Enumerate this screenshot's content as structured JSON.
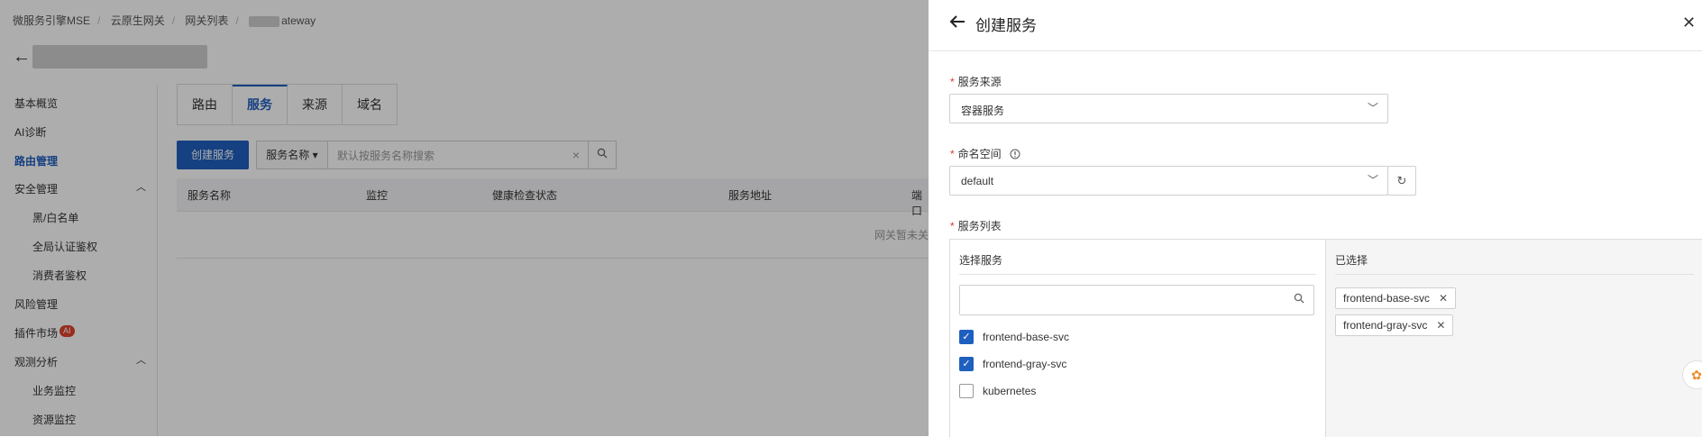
{
  "breadcrumb": [
    "微服务引擎MSE",
    "云原生网关",
    "网关列表",
    "ateway"
  ],
  "sidebar": {
    "items": [
      {
        "label": "基本概览"
      },
      {
        "label": "AI诊断"
      },
      {
        "label": "路由管理"
      },
      {
        "label": "安全管理"
      },
      {
        "label": "黑/白名单"
      },
      {
        "label": "全局认证鉴权"
      },
      {
        "label": "消费者鉴权"
      },
      {
        "label": "风险管理"
      },
      {
        "label": "插件市场",
        "badge": "AI"
      },
      {
        "label": "观测分析"
      },
      {
        "label": "业务监控"
      },
      {
        "label": "资源监控"
      }
    ]
  },
  "tabs": [
    "路由",
    "服务",
    "来源",
    "域名"
  ],
  "toolbar": {
    "create_label": "创建服务",
    "search_field_label": "服务名称",
    "search_placeholder": "默认按服务名称搜索"
  },
  "table": {
    "columns": [
      "服务名称",
      "监控",
      "健康检查状态",
      "服务地址",
      "端口"
    ],
    "empty_text": "网关暂未关"
  },
  "drawer": {
    "title": "创建服务",
    "source": {
      "label": "服务来源",
      "value": "容器服务"
    },
    "namespace": {
      "label": "命名空间",
      "value": "default"
    },
    "service_list": {
      "label": "服务列表",
      "left_title": "选择服务",
      "right_title": "已选择",
      "options": [
        {
          "name": "frontend-base-svc",
          "checked": true
        },
        {
          "name": "frontend-gray-svc",
          "checked": true
        },
        {
          "name": "kubernetes",
          "checked": false
        }
      ],
      "selected": [
        "frontend-base-svc",
        "frontend-gray-svc"
      ]
    }
  },
  "colors": {
    "accent": "#1f5fbf",
    "required": "#d9363e",
    "badge": "#e0412d"
  }
}
